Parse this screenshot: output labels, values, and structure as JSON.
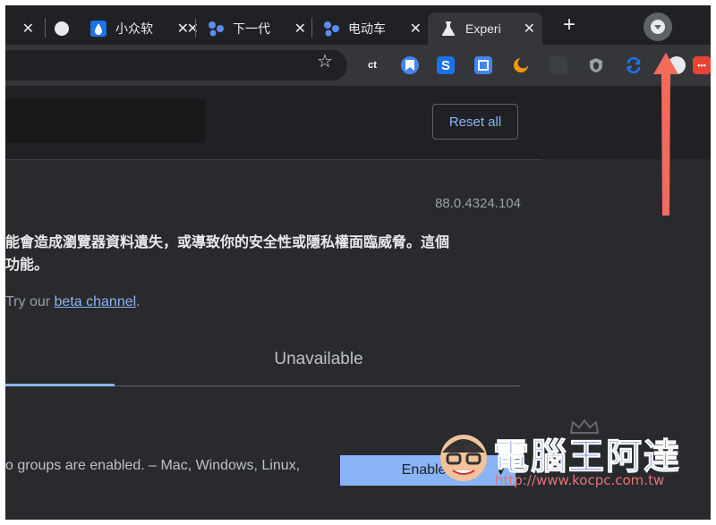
{
  "tabs": [
    {
      "title": "",
      "close": "✕"
    },
    {
      "title": "",
      "close": "✕"
    },
    {
      "title": "小众软",
      "close": "✕"
    },
    {
      "title": "下一代",
      "close": "✕"
    },
    {
      "title": "电动车",
      "close": "✕"
    },
    {
      "title": "Experi",
      "close": "✕"
    }
  ],
  "toolbar": {
    "new_tab": "+",
    "star": "☆",
    "extensions": [
      {
        "icon": "ct-extension-icon",
        "label": "ct",
        "color": "#35363a"
      },
      {
        "icon": "bookmark-extension-icon",
        "label": "",
        "color": "#4285f4"
      },
      {
        "icon": "s-extension-icon",
        "label": "S",
        "color": "#1a73e8"
      },
      {
        "icon": "translate-extension-icon",
        "label": "",
        "color": "#4285f4"
      },
      {
        "icon": "moon-extension-icon",
        "label": "",
        "color": "#ff9800"
      },
      {
        "icon": "grid-extension-icon",
        "label": "",
        "color": "#3c4043"
      },
      {
        "icon": "shield-extension-icon",
        "label": "",
        "color": "#9aa0a6"
      },
      {
        "icon": "sync-extension-icon",
        "label": "",
        "color": "#1a73e8"
      },
      {
        "icon": "profile-icon",
        "label": "",
        "color": "#e8eaed"
      },
      {
        "icon": "more-extension-icon",
        "label": "•••",
        "color": "#ea4335"
      }
    ]
  },
  "flags": {
    "reset_label": "Reset all",
    "version": "88.0.4324.104",
    "warning_line1": "能會造成瀏覽器資料遺失，或導致你的安全性或隱私權面臨威脅。這個",
    "warning_line2": "功能。",
    "beta_prefix": "Try our ",
    "beta_link": "beta channel",
    "beta_suffix": ".",
    "tab_unavailable": "Unavailable",
    "flag_description": "o groups are enabled. – Mac, Windows, Linux,",
    "flag_select_value": "Enabled"
  },
  "watermark": {
    "name": "電腦王阿達",
    "url": "http://www.kocpc.com.tw"
  },
  "colors": {
    "accent": "#8ab4f8",
    "background": "#202124",
    "arrow": "#f26b5b"
  }
}
